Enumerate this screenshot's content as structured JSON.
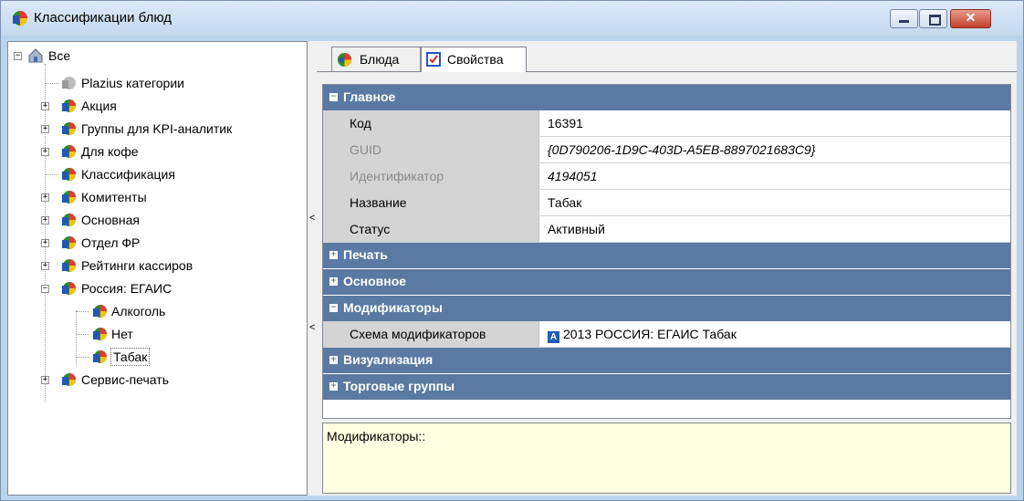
{
  "window": {
    "title": "Классификации блюд"
  },
  "window_buttons": {
    "minimize": "—",
    "maximize": "□",
    "close": "✕"
  },
  "tree": {
    "root": "Все",
    "items": [
      {
        "label": "Plazius категории"
      },
      {
        "label": "Акция"
      },
      {
        "label": "Группы для KPI-аналитик"
      },
      {
        "label": "Для кофе"
      },
      {
        "label": "Классификация"
      },
      {
        "label": "Комитенты"
      },
      {
        "label": "Основная"
      },
      {
        "label": "Отдел ФР"
      },
      {
        "label": "Рейтинги кассиров"
      },
      {
        "label": "Россия: ЕГАИС"
      },
      {
        "label": "Алкоголь"
      },
      {
        "label": "Нет"
      },
      {
        "label": "Табак"
      },
      {
        "label": "Сервис-печать"
      }
    ]
  },
  "tabs": [
    {
      "label": "Блюда"
    },
    {
      "label": "Свойства"
    }
  ],
  "properties": {
    "main_header": "Главное",
    "code_label": "Код",
    "code_value": "16391",
    "guid_label": "GUID",
    "guid_value": "{0D790206-1D9C-403D-A5EB-8897021683C9}",
    "id_label": "Идентификатор",
    "id_value": "4194051",
    "name_label": "Название",
    "name_value": "Табак",
    "status_label": "Статус",
    "status_value": "Активный",
    "print_header": "Печать",
    "basic_header": "Основное",
    "modifiers_header": "Модификаторы",
    "scheme_label": "Схема модификаторов",
    "scheme_value": "2013 РОССИЯ: ЕГАИС Табак",
    "visual_header": "Визуализация",
    "trade_header": "Торговые группы"
  },
  "description": {
    "text": "Модификаторы::"
  },
  "colors": {
    "category_header": "#5b7aa3",
    "description_bg": "#ffffe1"
  }
}
